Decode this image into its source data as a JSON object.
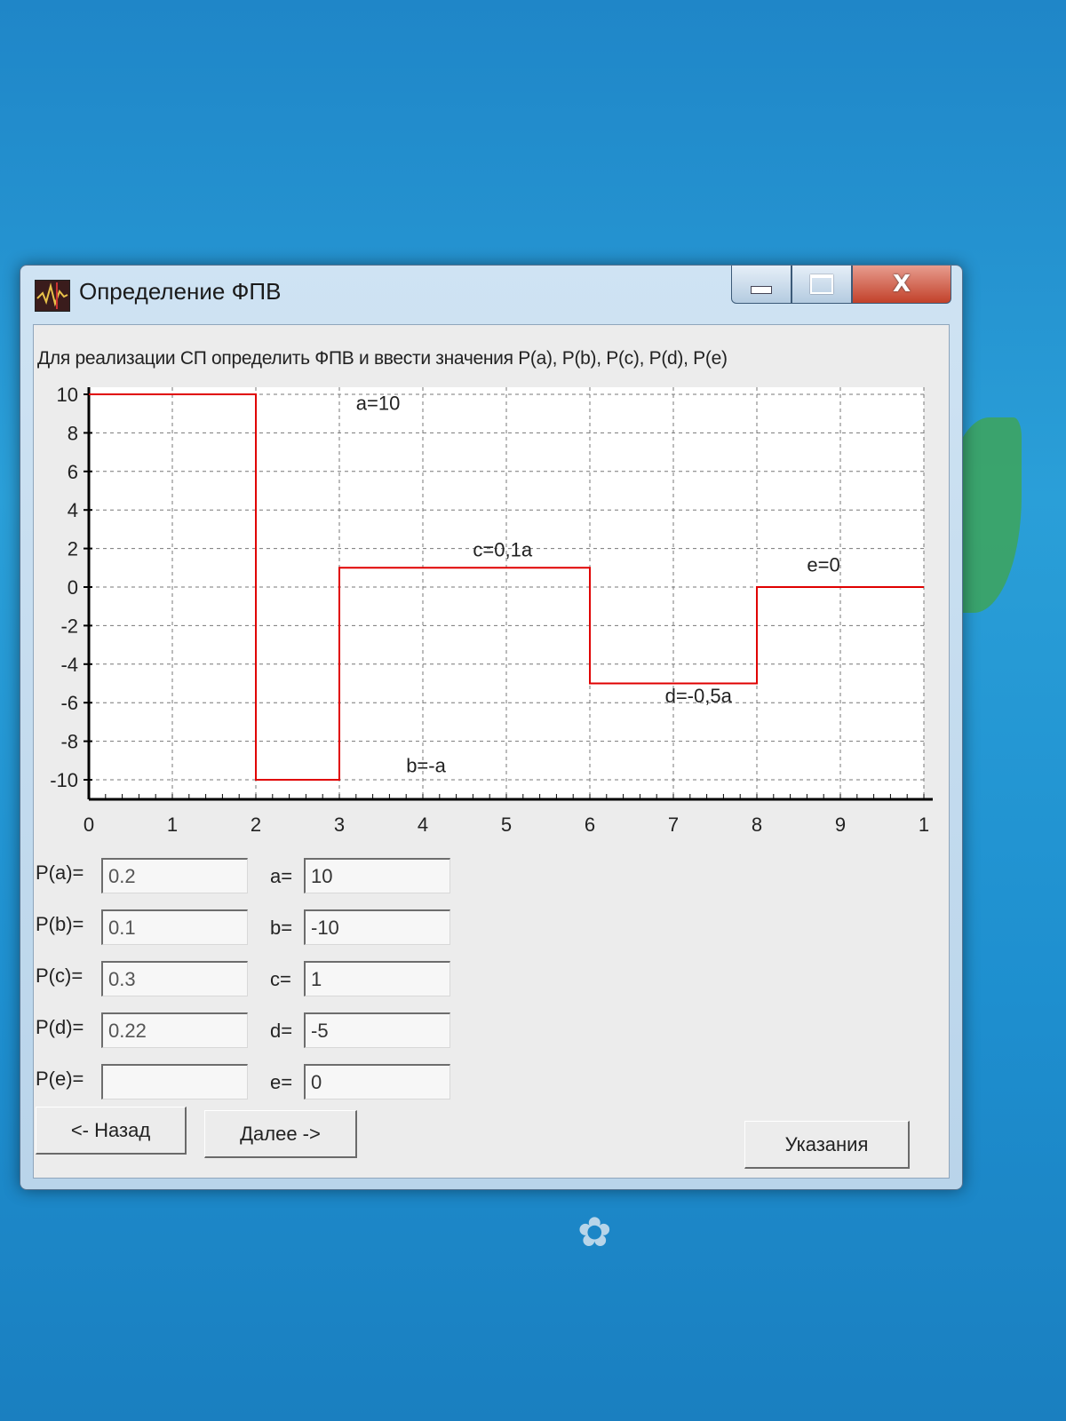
{
  "window": {
    "title": "Определение ФПВ",
    "caption_buttons": {
      "minimize": "",
      "maximize": "",
      "close": "X"
    }
  },
  "instruction": "Для реализации СП определить ФПВ и ввести значения P(a), P(b), P(c), P(d), P(e)",
  "chart_data": {
    "type": "line",
    "x_ticks": [
      "0",
      "1",
      "2",
      "3",
      "4",
      "5",
      "6",
      "7",
      "8",
      "9",
      "1"
    ],
    "y_ticks": [
      "10",
      "8",
      "6",
      "4",
      "2",
      "0",
      "-2",
      "-4",
      "-6",
      "-8",
      "-10"
    ],
    "xlim": [
      0,
      10
    ],
    "ylim": [
      -10,
      10
    ],
    "grid": true,
    "series": [
      {
        "points": [
          [
            0,
            10
          ],
          [
            2,
            10
          ],
          [
            2,
            -10
          ],
          [
            3,
            -10
          ],
          [
            3,
            1
          ],
          [
            6,
            1
          ],
          [
            6,
            -5
          ],
          [
            8,
            -5
          ],
          [
            8,
            0
          ],
          [
            10,
            0
          ]
        ],
        "color": "#e00000"
      }
    ],
    "annotations": [
      {
        "text": "a=10",
        "x": 3.2,
        "y": 9.2
      },
      {
        "text": "b=-a",
        "x": 3.8,
        "y": -9.6
      },
      {
        "text": "c=0,1a",
        "x": 4.6,
        "y": 1.6
      },
      {
        "text": "d=-0,5a",
        "x": 6.9,
        "y": -6.0
      },
      {
        "text": "e=0",
        "x": 8.6,
        "y": 0.8
      }
    ]
  },
  "prob_fields": [
    {
      "label": "P(a)=",
      "value": "0.2"
    },
    {
      "label": "P(b)=",
      "value": "0.1"
    },
    {
      "label": "P(c)=",
      "value": "0.3"
    },
    {
      "label": "P(d)=",
      "value": "0.22"
    },
    {
      "label": "P(e)=",
      "value": ""
    }
  ],
  "value_fields": [
    {
      "label": "a=",
      "value": "10"
    },
    {
      "label": "b=",
      "value": "-10"
    },
    {
      "label": "c=",
      "value": "1"
    },
    {
      "label": "d=",
      "value": "-5"
    },
    {
      "label": "e=",
      "value": "0"
    }
  ],
  "buttons": {
    "back": "<- Назад",
    "next": "Далее ->",
    "hints": "Указания"
  }
}
